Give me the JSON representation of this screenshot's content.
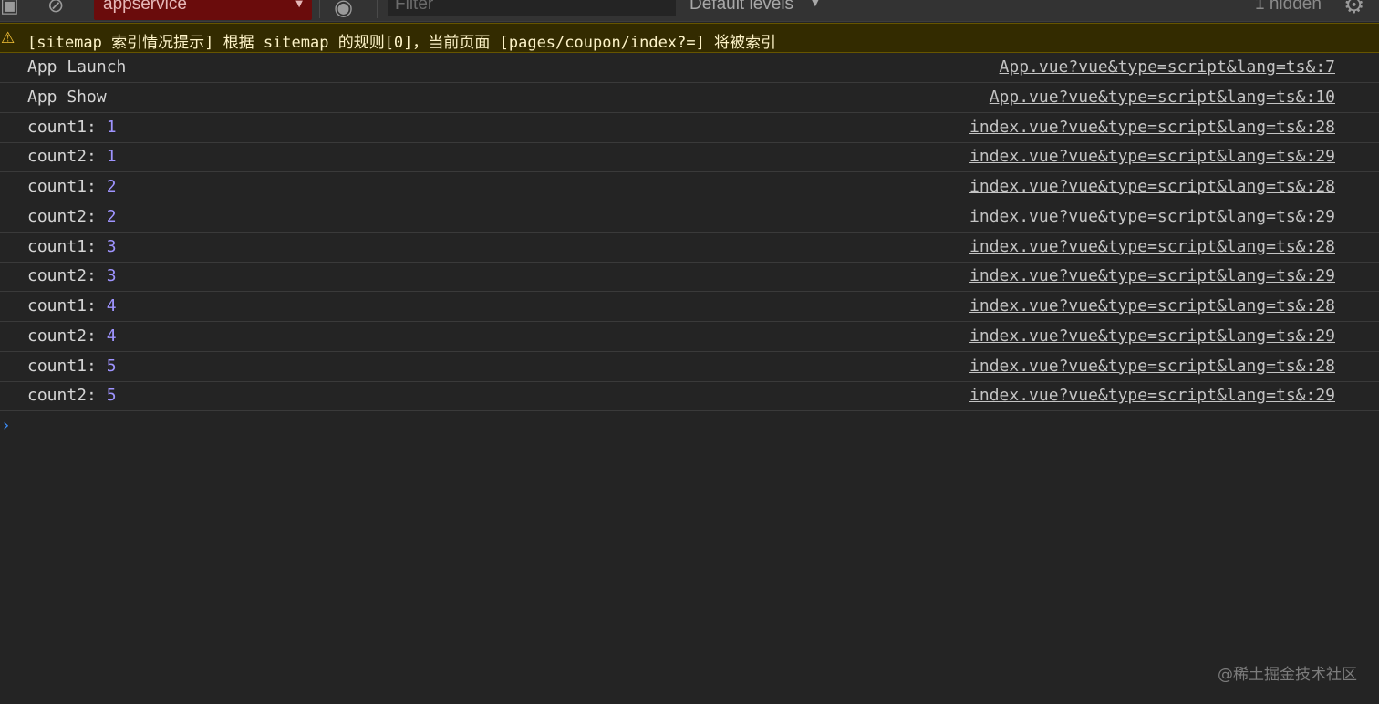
{
  "toolbar": {
    "context": "appservice",
    "filter_placeholder": "Filter",
    "levels": "Default levels",
    "hidden": "1 hidden"
  },
  "warning": "[sitemap 索引情况提示] 根据 sitemap 的规则[0]，当前页面 [pages/coupon/index?=] 将被索引",
  "rows": [
    {
      "text": "App Launch",
      "value": "",
      "source": "App.vue?vue&type=script&lang=ts&:7"
    },
    {
      "text": "App Show",
      "value": "",
      "source": "App.vue?vue&type=script&lang=ts&:10"
    },
    {
      "text": "count1:",
      "value": "1",
      "source": "index.vue?vue&type=script&lang=ts&:28"
    },
    {
      "text": "count2:",
      "value": "1",
      "source": "index.vue?vue&type=script&lang=ts&:29"
    },
    {
      "text": "count1:",
      "value": "2",
      "source": "index.vue?vue&type=script&lang=ts&:28"
    },
    {
      "text": "count2:",
      "value": "2",
      "source": "index.vue?vue&type=script&lang=ts&:29"
    },
    {
      "text": "count1:",
      "value": "3",
      "source": "index.vue?vue&type=script&lang=ts&:28"
    },
    {
      "text": "count2:",
      "value": "3",
      "source": "index.vue?vue&type=script&lang=ts&:29"
    },
    {
      "text": "count1:",
      "value": "4",
      "source": "index.vue?vue&type=script&lang=ts&:28"
    },
    {
      "text": "count2:",
      "value": "4",
      "source": "index.vue?vue&type=script&lang=ts&:29"
    },
    {
      "text": "count1:",
      "value": "5",
      "source": "index.vue?vue&type=script&lang=ts&:28"
    },
    {
      "text": "count2:",
      "value": "5",
      "source": "index.vue?vue&type=script&lang=ts&:29"
    }
  ],
  "watermark": "@稀土掘金技术社区",
  "colors": {
    "number": "#9f94ff",
    "warning_bg": "#332b00",
    "context_bg": "#6a0c0c"
  }
}
